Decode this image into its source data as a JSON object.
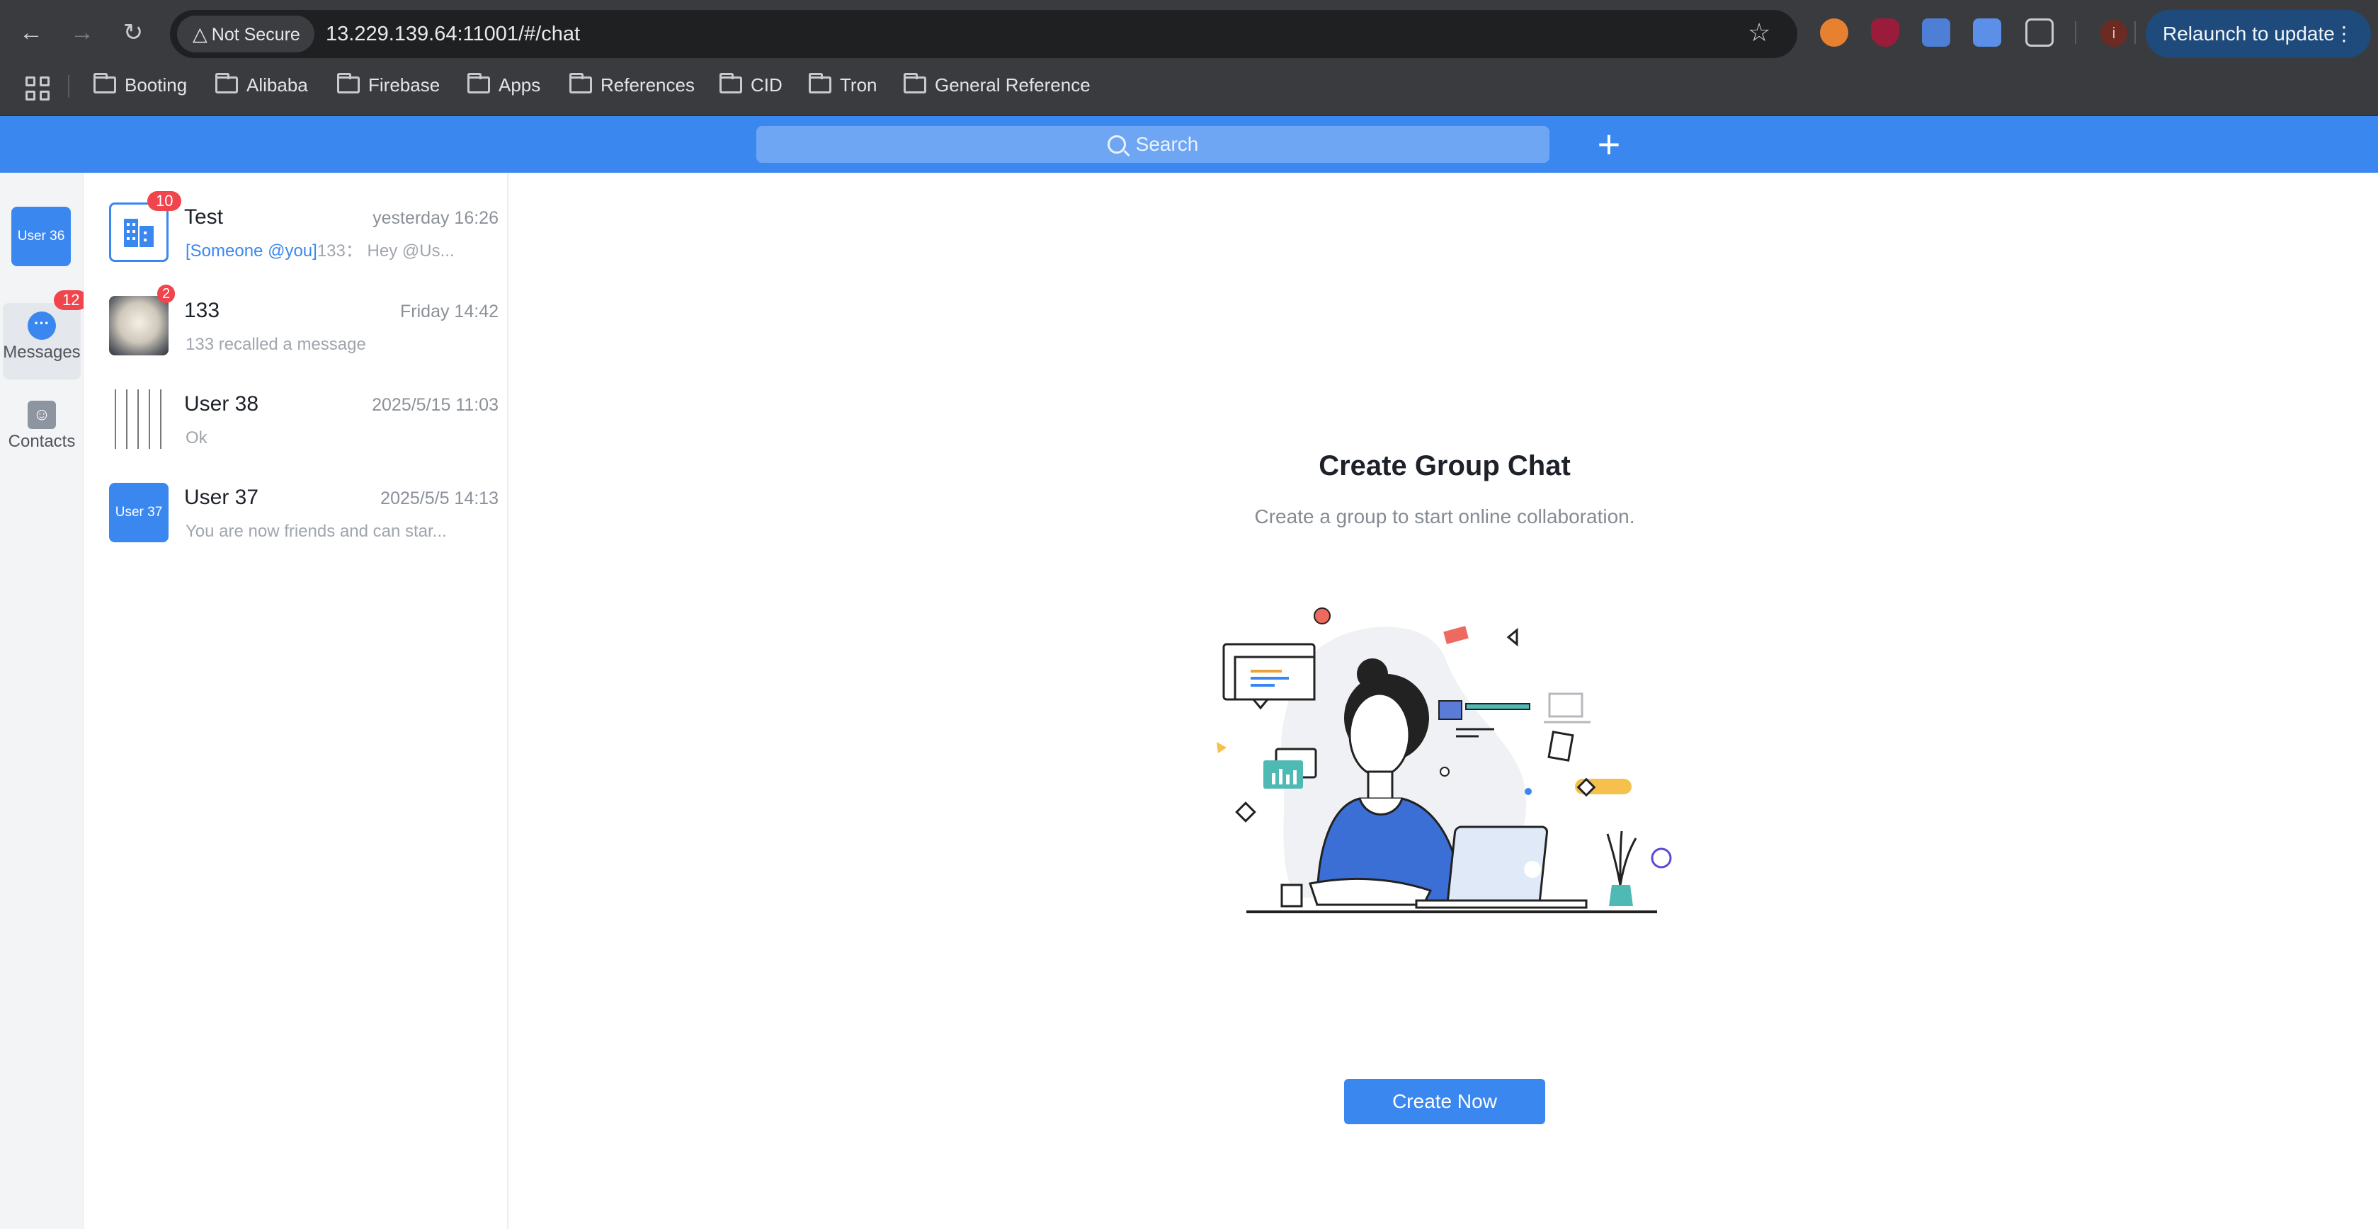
{
  "browser": {
    "not_secure_label": "Not Secure",
    "url": "13.229.139.64:11001/#/chat",
    "relaunch_label": "Relaunch to update",
    "profile_initial": "i",
    "bookmarks": [
      "Booting",
      "Alibaba",
      "Firebase",
      "Apps",
      "References",
      "CID",
      "Tron",
      "General Reference"
    ]
  },
  "header": {
    "search_placeholder": "Search",
    "add_label": "+"
  },
  "rail": {
    "user_avatar_text": "User 36",
    "messages_label": "Messages",
    "messages_badge": "12",
    "contacts_label": "Contacts"
  },
  "conversations": [
    {
      "name": "Test",
      "time": "yesterday 16:26",
      "mention": "[Someone @you]",
      "message": "133： Hey @Us...",
      "badge": "10"
    },
    {
      "name": "133",
      "time": "Friday 14:42",
      "message": "133 recalled a message",
      "badge": "2"
    },
    {
      "name": "User 38",
      "time": "2025/5/15 11:03",
      "message": "Ok"
    },
    {
      "name": "User 37",
      "time": "2025/5/5 14:13",
      "message": "You are now friends and can star...",
      "avatar_text": "User 37"
    }
  ],
  "empty_state": {
    "title": "Create Group Chat",
    "subtitle": "Create a group to start online collaboration.",
    "button_label": "Create Now"
  },
  "colors": {
    "accent": "#3b87f0",
    "badge": "#f0454c",
    "chrome": "#3a3b3e"
  }
}
